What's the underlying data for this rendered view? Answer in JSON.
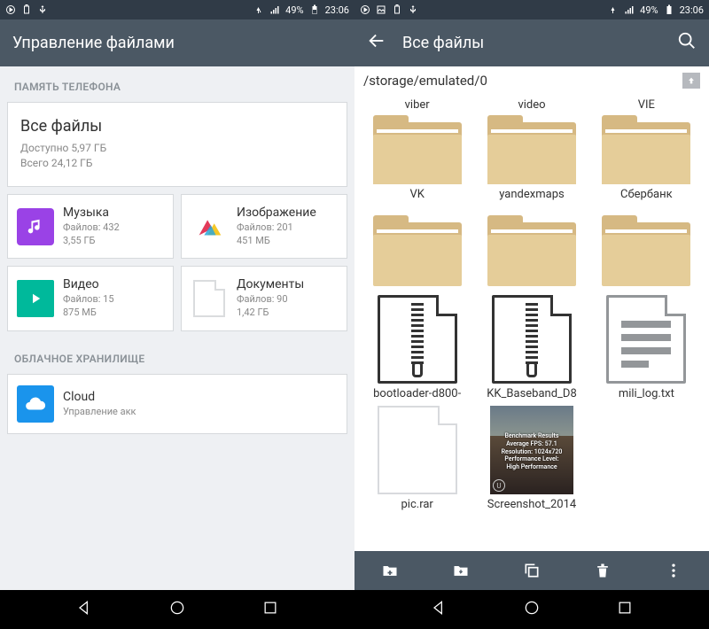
{
  "status": {
    "battery": "49%",
    "time": "23:06"
  },
  "left": {
    "title": "Управление файлами",
    "section_phone": "ПАМЯТЬ ТЕЛЕФОНА",
    "all": {
      "title": "Все файлы",
      "avail": "Доступно 5,97 ГБ",
      "total": "Всего 24,12 ГБ"
    },
    "cats": {
      "music": {
        "label": "Музыка",
        "files": "Файлов: 432",
        "size": "3,55 ГБ"
      },
      "images": {
        "label": "Изображение",
        "files": "Файлов: 201",
        "size": "451 МБ"
      },
      "video": {
        "label": "Видео",
        "files": "Файлов: 15",
        "size": "875 МБ"
      },
      "docs": {
        "label": "Документы",
        "files": "Файлов: 90",
        "size": "1,42 ГБ"
      }
    },
    "section_cloud": "ОБЛАЧНОЕ ХРАНИЛИЩЕ",
    "cloud": {
      "label": "Cloud",
      "sub": "Управление акк"
    }
  },
  "right": {
    "title": "Все файлы",
    "path": "/storage/emulated/0",
    "items": [
      {
        "label": "viber",
        "kind": "folder"
      },
      {
        "label": "video",
        "kind": "folder"
      },
      {
        "label": "VIE",
        "kind": "folder"
      },
      {
        "label": "VK",
        "kind": "folder"
      },
      {
        "label": "yandexmaps",
        "kind": "folder"
      },
      {
        "label": "Сбербанк",
        "kind": "folder"
      },
      {
        "label": "bootloader-d800-",
        "kind": "zip"
      },
      {
        "label": "KK_Baseband_D8",
        "kind": "zip"
      },
      {
        "label": "mili_log.txt",
        "kind": "doc"
      },
      {
        "label": "pic.rar",
        "kind": "blank"
      },
      {
        "label": "Screenshot_2014",
        "kind": "screenshot"
      }
    ],
    "screenshot_overlay": {
      "l1": "Benchmark Results",
      "l2": "Average FPS: 57.1",
      "l3": "Resolution: 1024x720",
      "l4": "Performance Level:",
      "l5": "High Performance"
    }
  }
}
